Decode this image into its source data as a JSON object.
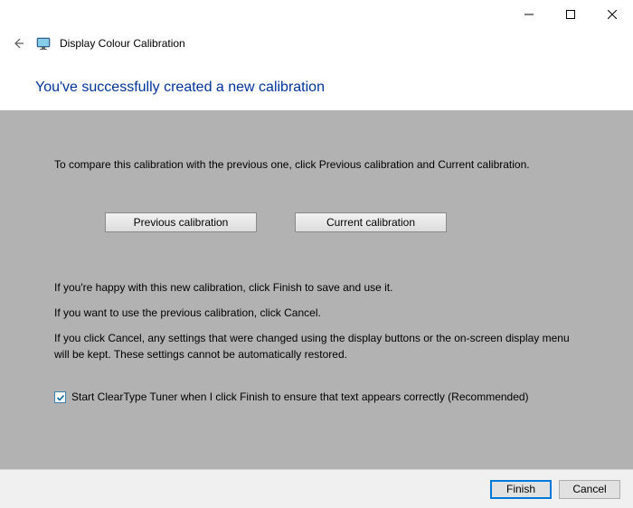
{
  "window": {
    "title": "Display Colour Calibration"
  },
  "heading": "You've successfully created a new calibration",
  "content": {
    "compare_text": "To compare this calibration with the previous one, click Previous calibration and Current calibration.",
    "btn_previous": "Previous calibration",
    "btn_current": "Current calibration",
    "happy_text": "If you're happy with this new calibration, click Finish to save and use it.",
    "use_previous_text": "If you want to use the previous calibration, click Cancel.",
    "cancel_note": "If you click Cancel, any settings that were changed using the display buttons or the on-screen display menu will be kept. These settings cannot be automatically restored.",
    "checkbox_label": "Start ClearType Tuner when I click Finish to ensure that text appears correctly (Recommended)"
  },
  "footer": {
    "finish": "Finish",
    "cancel": "Cancel"
  }
}
